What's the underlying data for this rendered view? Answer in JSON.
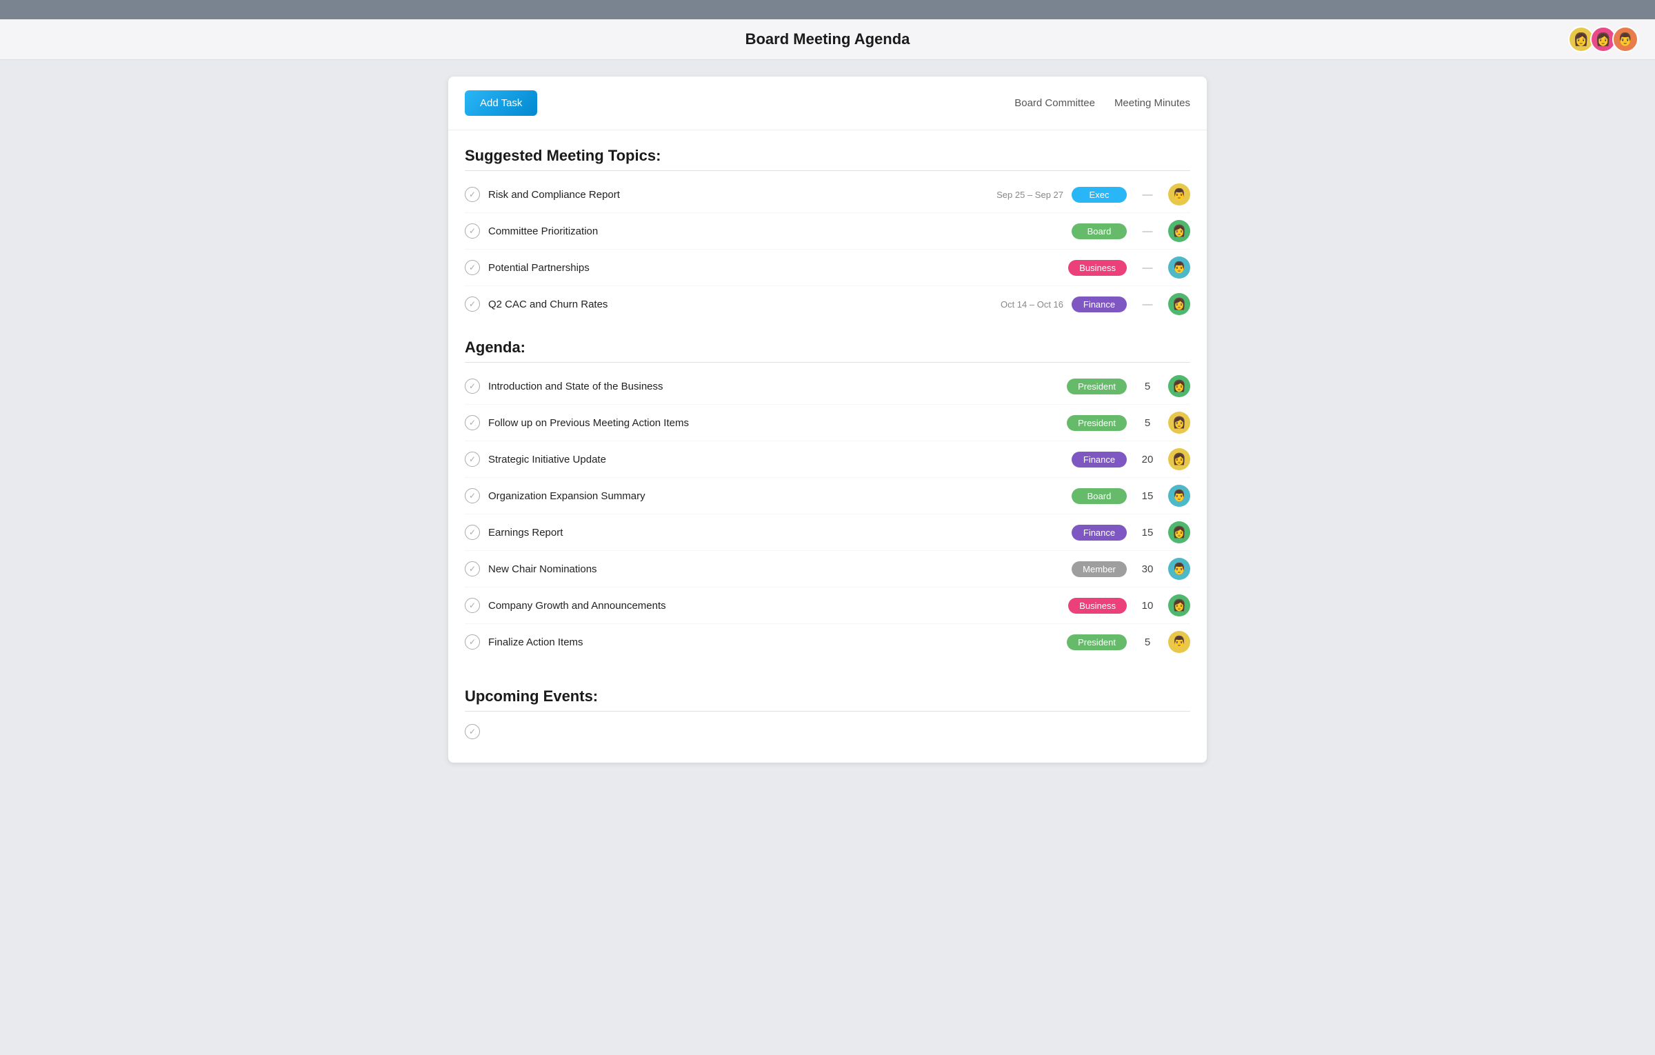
{
  "topbar": {},
  "header": {
    "title": "Board Meeting Agenda",
    "avatars": [
      {
        "id": "avatar-1",
        "color": "av-yellow",
        "emoji": "👩"
      },
      {
        "id": "avatar-2",
        "color": "av-pink",
        "emoji": "👩"
      },
      {
        "id": "avatar-3",
        "color": "av-orange",
        "emoji": "👨"
      }
    ]
  },
  "toolbar": {
    "add_task_label": "Add Task",
    "nav_items": [
      {
        "label": "Board Committee",
        "id": "nav-board-committee"
      },
      {
        "label": "Meeting Minutes",
        "id": "nav-meeting-minutes"
      }
    ]
  },
  "suggested_topics": {
    "section_title": "Suggested Meeting Topics:",
    "items": [
      {
        "name": "Risk and Compliance Report",
        "date": "Sep 25 – Sep 27",
        "tag": "Exec",
        "tag_class": "tag-exec",
        "number": "—",
        "avatar_class": "av-yellow",
        "avatar_emoji": "👨"
      },
      {
        "name": "Committee Prioritization",
        "date": "",
        "tag": "Board",
        "tag_class": "tag-board",
        "number": "—",
        "avatar_class": "av-green",
        "avatar_emoji": "👩"
      },
      {
        "name": "Potential Partnerships",
        "date": "",
        "tag": "Business",
        "tag_class": "tag-business",
        "number": "—",
        "avatar_class": "av-cyan",
        "avatar_emoji": "👨"
      },
      {
        "name": "Q2 CAC and Churn Rates",
        "date": "Oct 14 – Oct 16",
        "tag": "Finance",
        "tag_class": "tag-finance",
        "number": "—",
        "avatar_class": "av-green",
        "avatar_emoji": "👩"
      }
    ]
  },
  "agenda": {
    "section_title": "Agenda:",
    "items": [
      {
        "name": "Introduction and State of the Business",
        "tag": "President",
        "tag_class": "tag-president",
        "number": "5",
        "avatar_class": "av-green",
        "avatar_emoji": "👩"
      },
      {
        "name": "Follow up on Previous Meeting Action Items",
        "tag": "President",
        "tag_class": "tag-president",
        "number": "5",
        "avatar_class": "av-yellow",
        "avatar_emoji": "👩"
      },
      {
        "name": "Strategic Initiative Update",
        "tag": "Finance",
        "tag_class": "tag-finance",
        "number": "20",
        "avatar_class": "av-yellow",
        "avatar_emoji": "👩"
      },
      {
        "name": "Organization Expansion Summary",
        "tag": "Board",
        "tag_class": "tag-board",
        "number": "15",
        "avatar_class": "av-cyan",
        "avatar_emoji": "👨"
      },
      {
        "name": "Earnings Report",
        "tag": "Finance",
        "tag_class": "tag-finance",
        "number": "15",
        "avatar_class": "av-green",
        "avatar_emoji": "👩"
      },
      {
        "name": "New Chair Nominations",
        "tag": "Member",
        "tag_class": "tag-member",
        "number": "30",
        "avatar_class": "av-cyan",
        "avatar_emoji": "👨"
      },
      {
        "name": "Company Growth and Announcements",
        "tag": "Business",
        "tag_class": "tag-business",
        "number": "10",
        "avatar_class": "av-green",
        "avatar_emoji": "👩"
      },
      {
        "name": "Finalize Action Items",
        "tag": "President",
        "tag_class": "tag-president",
        "number": "5",
        "avatar_class": "av-yellow",
        "avatar_emoji": "👨"
      }
    ]
  },
  "upcoming_events": {
    "section_title": "Upcoming Events:"
  }
}
